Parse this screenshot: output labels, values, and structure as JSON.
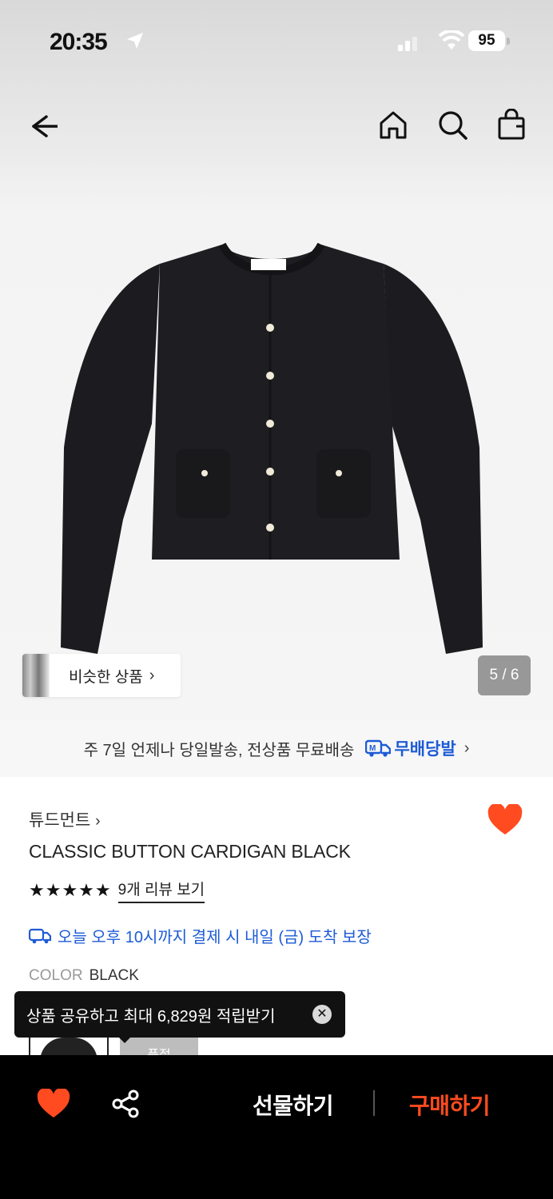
{
  "status_bar": {
    "time": "20:35",
    "battery": "95"
  },
  "nav": {
    "back_icon": "back-arrow-icon",
    "home_icon": "home-icon",
    "search_icon": "search-icon",
    "cart_icon": "shopping-bag-icon"
  },
  "gallery": {
    "similar_label": "비슷한 상품",
    "chevron": "›",
    "counter": "5 / 6"
  },
  "delivery_banner": {
    "text": "주 7일 언제나 당일발송, 전상품 무료배송",
    "badge": "무배당발",
    "chevron": "›"
  },
  "product": {
    "brand": "튜드먼트",
    "brand_chevron": "›",
    "name": "CLASSIC BUTTON CARDIGAN BLACK",
    "stars": "★★★★★",
    "review_link": "9개 리뷰 보기",
    "guarantee": "오늘 오후 10시까지 결제 시 내일 (금) 도착 보장",
    "color_key": "COLOR",
    "color_value": "BLACK",
    "option2_label": "품절"
  },
  "toast": {
    "text": "상품 공유하고 최대 6,829원 적립받기",
    "close": "✕"
  },
  "bottom_bar": {
    "gift": "선물하기",
    "buy": "구매하기"
  },
  "colors": {
    "accent_red": "#ff4b1f",
    "link_blue": "#1d5bd6",
    "heart": "#ff4b1f"
  }
}
